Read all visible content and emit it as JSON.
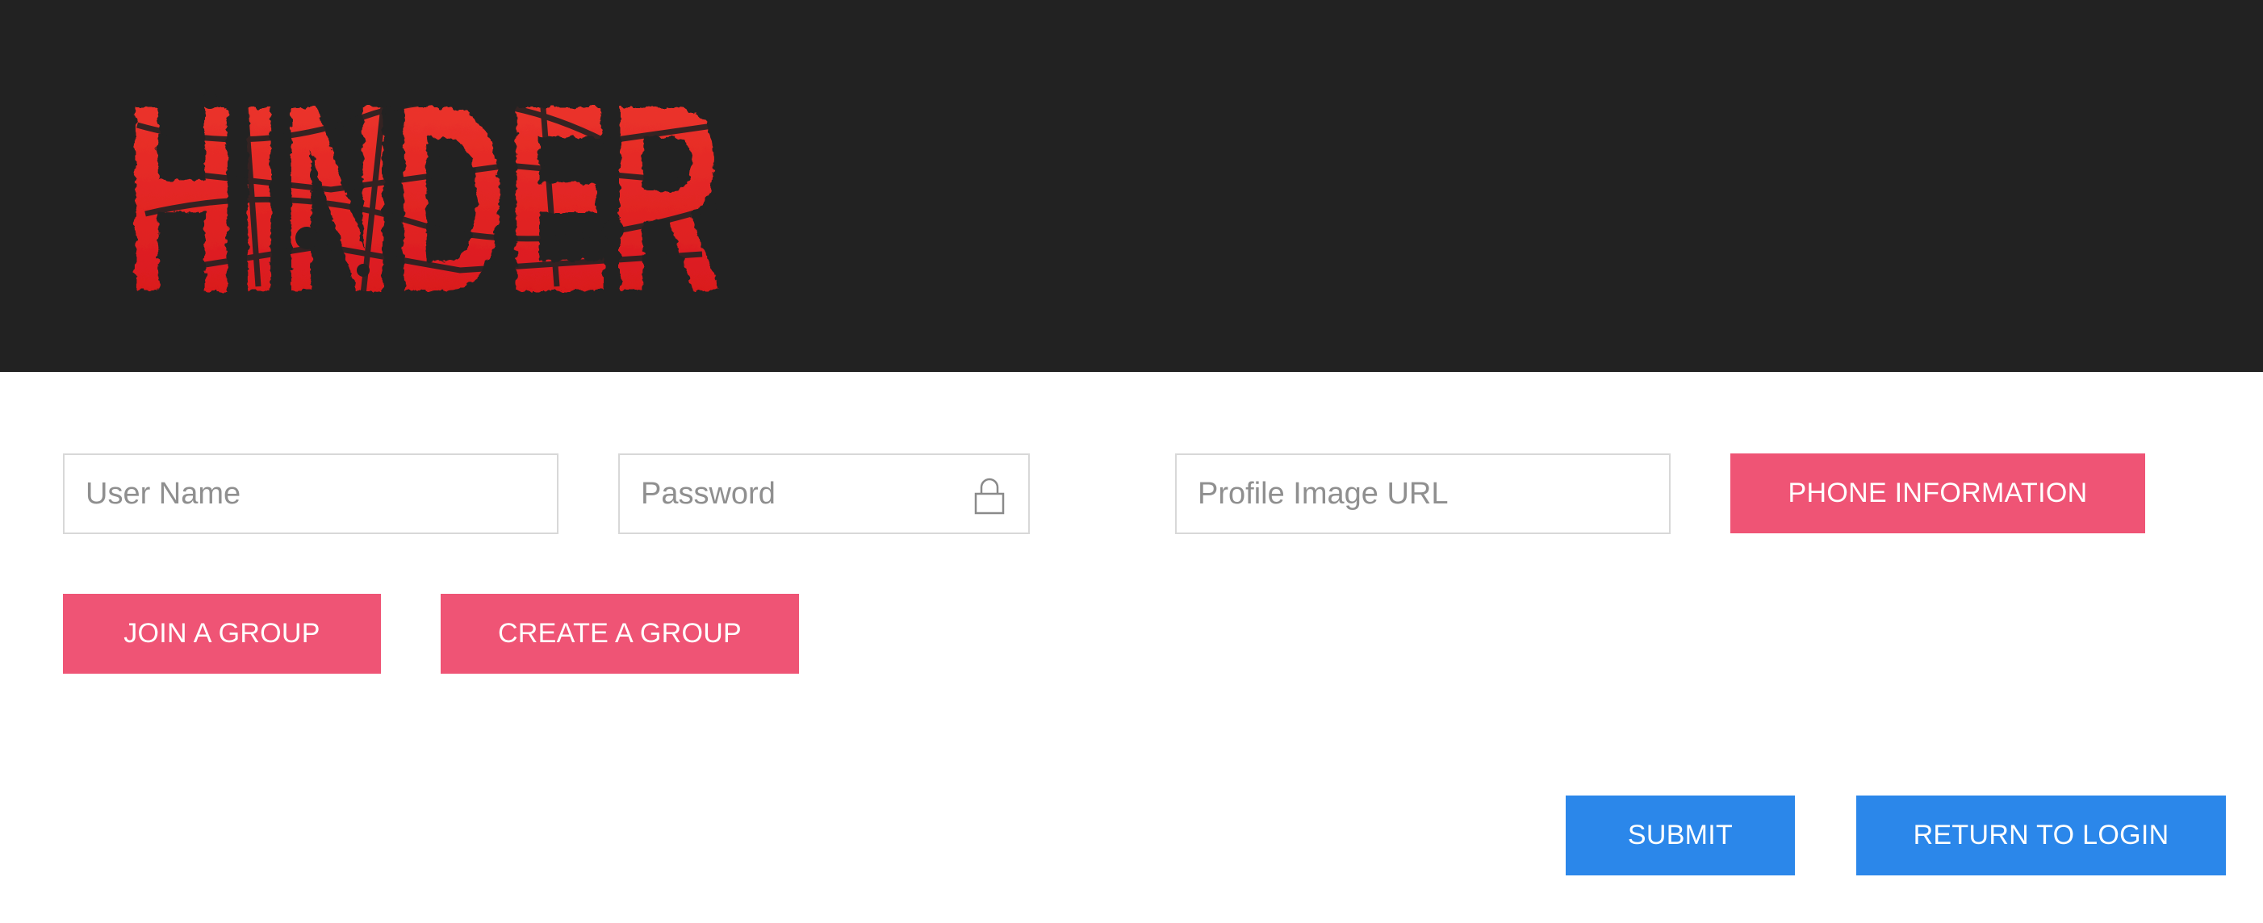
{
  "header": {
    "logo_text": "HINDER",
    "logo_color_top": "#f03030",
    "logo_color_bottom": "#d8121a",
    "background": "#222222"
  },
  "form": {
    "username_placeholder": "User Name",
    "password_placeholder": "Password",
    "profile_image_placeholder": "Profile Image URL",
    "lock_icon": "lock-icon"
  },
  "buttons": {
    "phone_information": "PHONE INFORMATION",
    "join_group": "JOIN A GROUP",
    "create_group": "CREATE A GROUP",
    "submit": "SUBMIT",
    "return_to_login": "RETURN TO LOGIN"
  },
  "colors": {
    "accent_pink": "#ef5475",
    "accent_blue": "#2b87ea"
  }
}
